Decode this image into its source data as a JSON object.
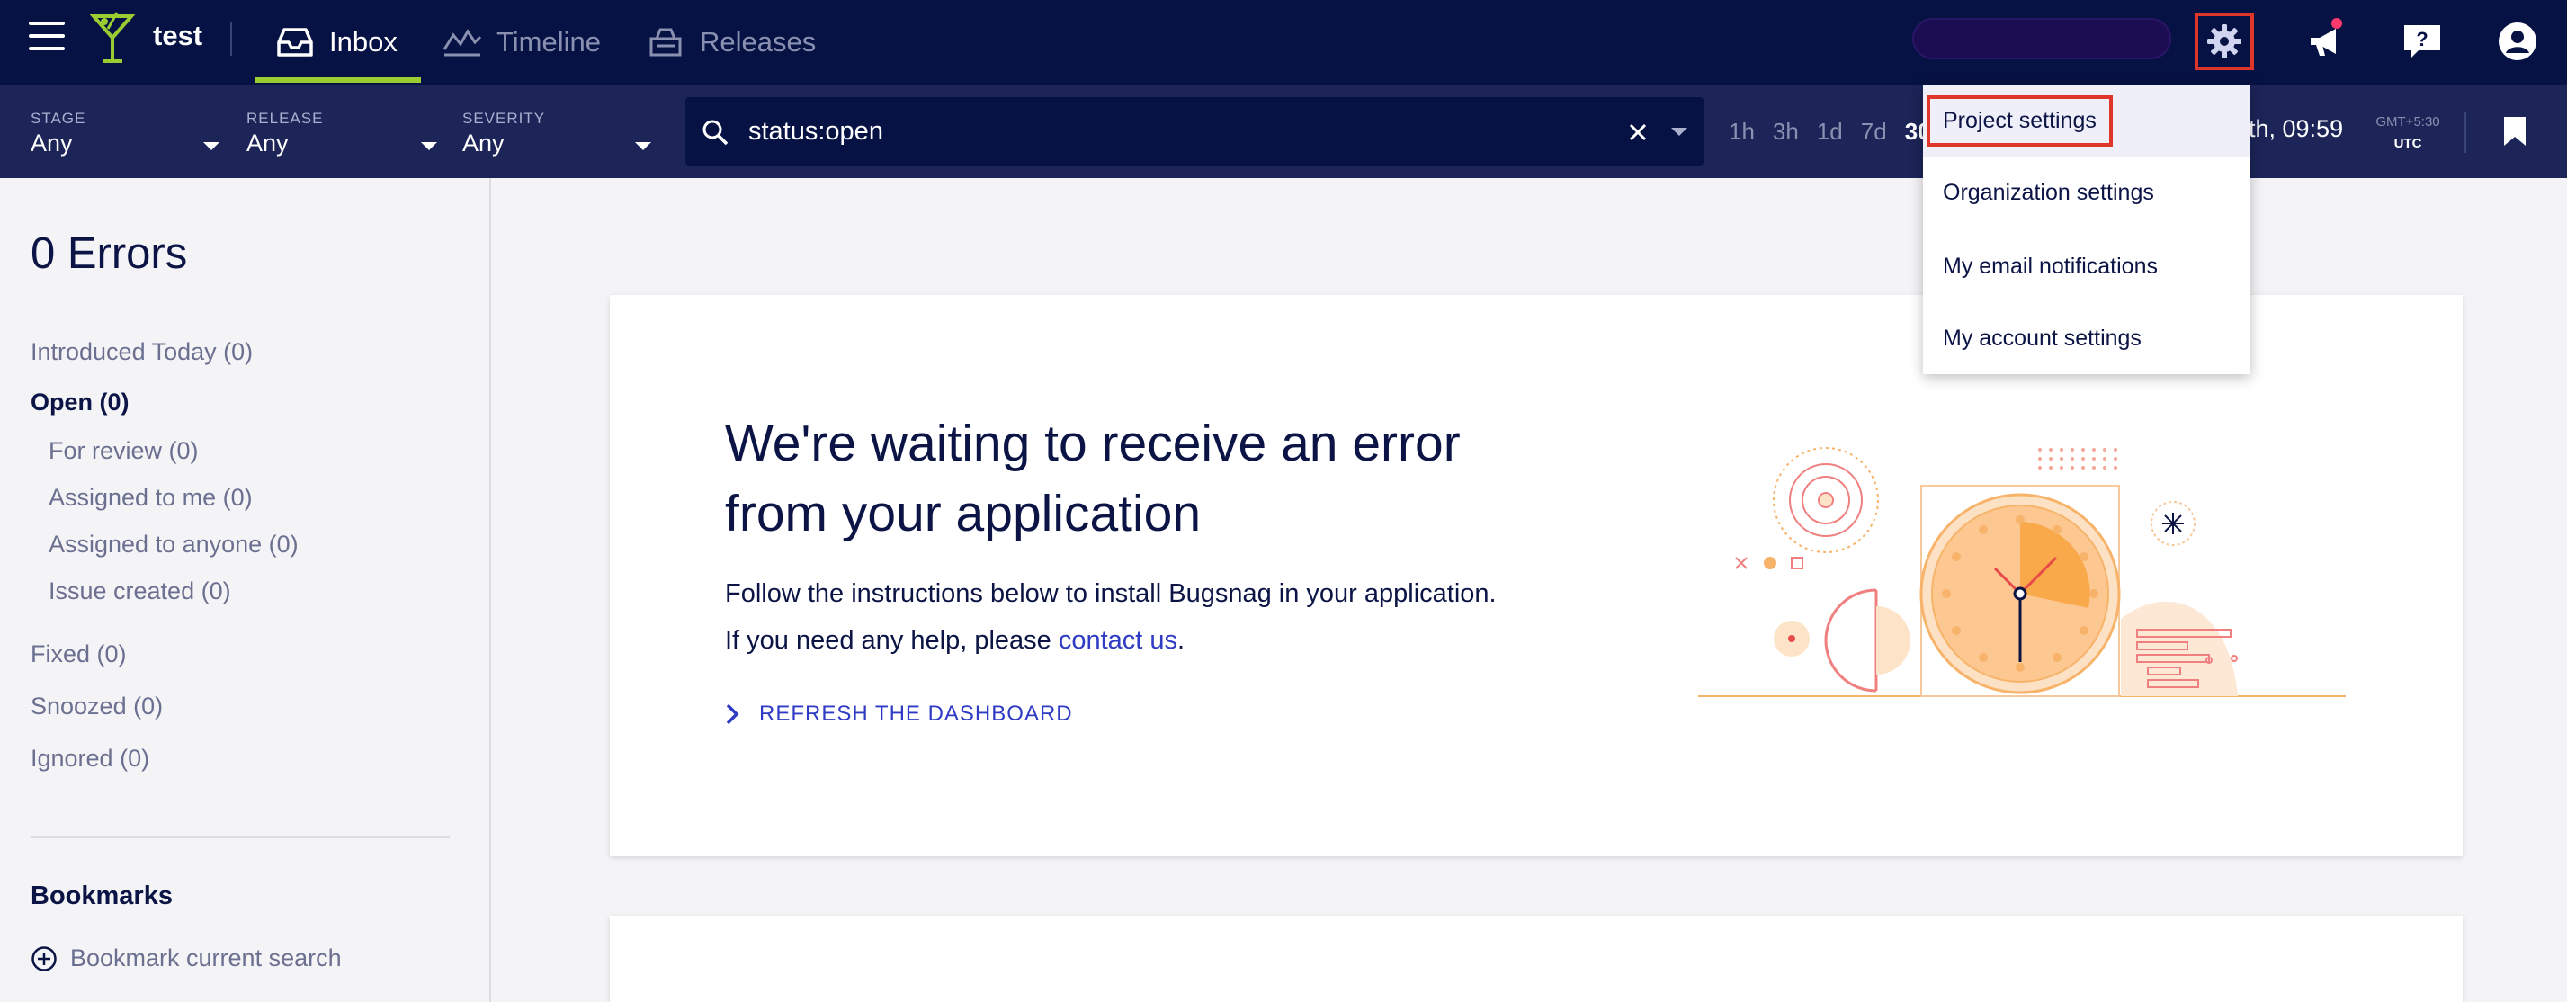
{
  "topbar": {
    "project_name": "test",
    "tabs": [
      {
        "label": "Inbox",
        "icon": "inbox-icon",
        "active": true
      },
      {
        "label": "Timeline",
        "icon": "timeline-icon",
        "active": false
      },
      {
        "label": "Releases",
        "icon": "releases-icon",
        "active": false
      }
    ],
    "icons": [
      "menu-icon",
      "logo-icon",
      "gear-icon",
      "megaphone-icon",
      "help-icon",
      "account-icon"
    ],
    "accent_underline": "#9acd32",
    "highlight_color": "#e0362a"
  },
  "filters": {
    "stage": {
      "label": "STAGE",
      "value": "Any"
    },
    "release": {
      "label": "RELEASE",
      "value": "Any"
    },
    "severity": {
      "label": "SEVERITY",
      "value": "Any"
    },
    "search_value": "status:open",
    "time_ranges": [
      "1h",
      "3h",
      "1d",
      "7d",
      "30d"
    ],
    "selected_range": "30d",
    "date_text": "th, 09:59",
    "tz_offset": "GMT+5:30",
    "tz_label": "UTC"
  },
  "sidebar": {
    "title": "0 Errors",
    "items": [
      {
        "label": "Introduced Today (0)"
      },
      {
        "label": "Open (0)"
      },
      {
        "label": "For review (0)"
      },
      {
        "label": "Assigned to me (0)"
      },
      {
        "label": "Assigned to anyone (0)"
      },
      {
        "label": "Issue created (0)"
      },
      {
        "label": "Fixed (0)"
      },
      {
        "label": "Snoozed (0)"
      },
      {
        "label": "Ignored (0)"
      }
    ],
    "bookmarks_heading": "Bookmarks",
    "bookmark_action": "Bookmark current search"
  },
  "main": {
    "heading": "We're waiting to receive an error from your application",
    "body_prefix": "Follow the instructions below to install Bugsnag in your application. If you need any help, please ",
    "contact_link": "contact us",
    "body_suffix": ".",
    "refresh_label": "REFRESH THE DASHBOARD"
  },
  "settings_menu": {
    "items": [
      {
        "label": "Project settings"
      },
      {
        "label": "Organization settings"
      },
      {
        "label": "My email notifications"
      },
      {
        "label": "My account settings"
      }
    ]
  }
}
